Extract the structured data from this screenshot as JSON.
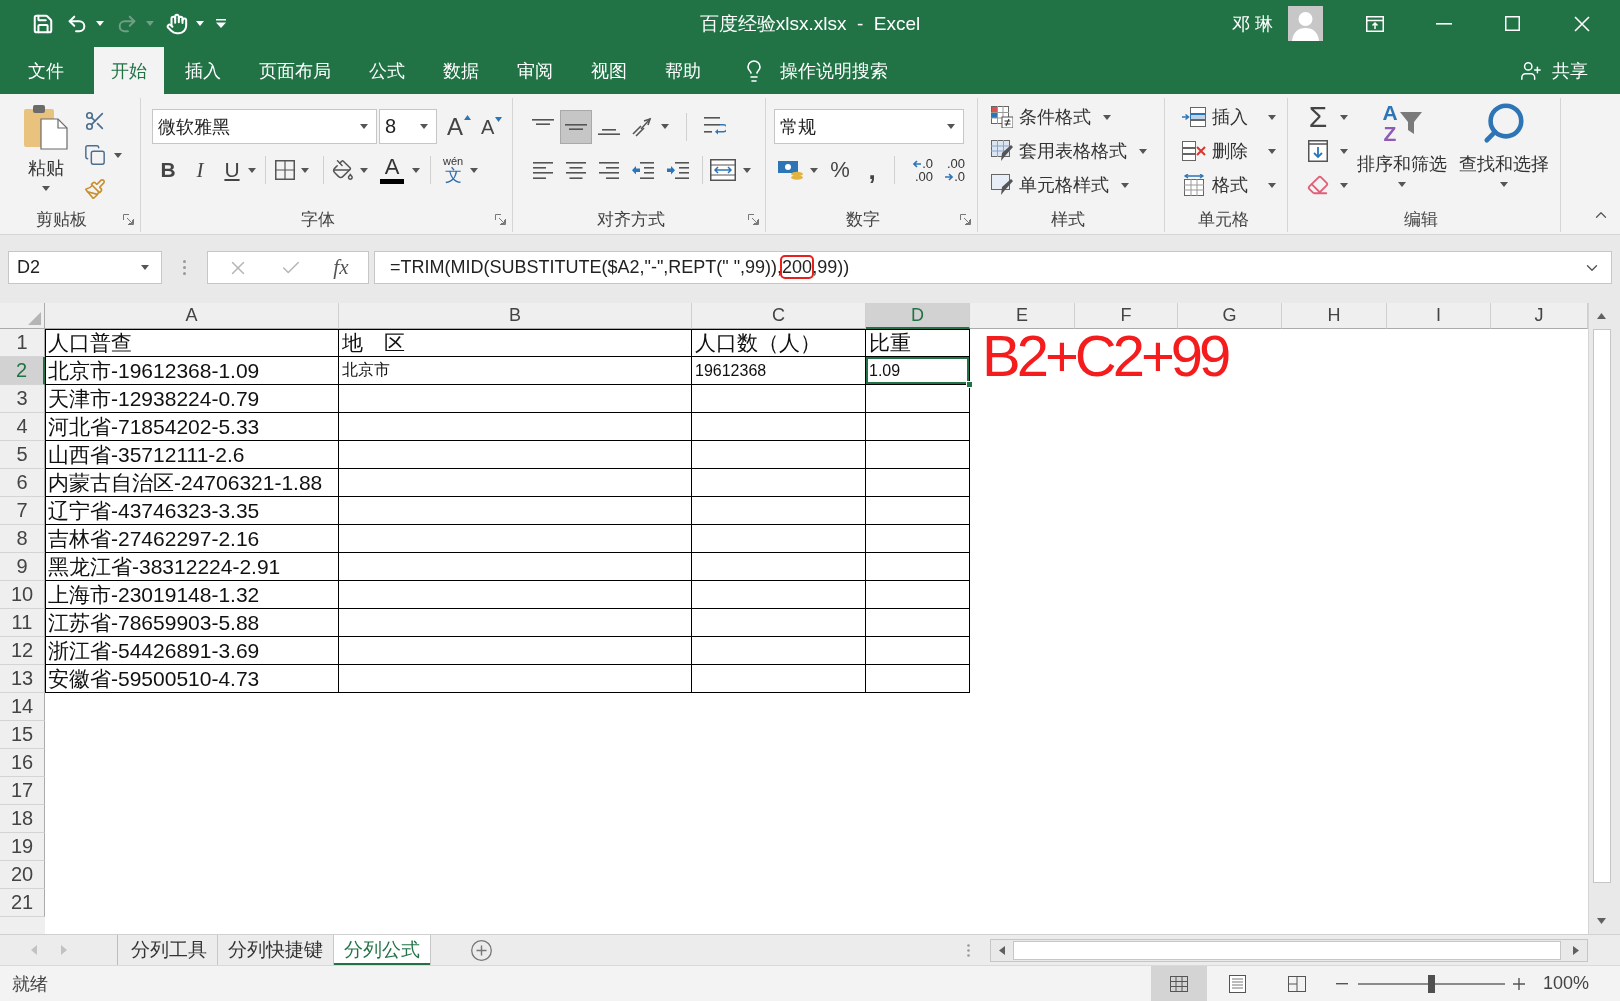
{
  "title_bar": {
    "quick_access": [
      {
        "kind": "save",
        "disabled": false,
        "menu": false
      },
      {
        "kind": "undo",
        "disabled": false,
        "menu": true
      },
      {
        "kind": "redo",
        "disabled": true,
        "menu": true
      },
      {
        "kind": "touch",
        "disabled": false,
        "menu": true
      },
      {
        "kind": "customize",
        "disabled": false,
        "menu": false
      }
    ],
    "title": "百度经验xlsx.xlsx  -  Excel",
    "user": "邓 琳"
  },
  "menu_tabs": [
    {
      "label": "文件",
      "selected": false
    },
    {
      "label": "开始",
      "selected": true
    },
    {
      "label": "插入",
      "selected": false
    },
    {
      "label": "页面布局",
      "selected": false
    },
    {
      "label": "公式",
      "selected": false
    },
    {
      "label": "数据",
      "selected": false
    },
    {
      "label": "审阅",
      "selected": false
    },
    {
      "label": "视图",
      "selected": false
    },
    {
      "label": "帮助",
      "selected": false
    }
  ],
  "tell_me": "操作说明搜索",
  "share": "共享",
  "ribbon": {
    "groups": [
      {
        "kind": "clipboard",
        "label": "剪贴板",
        "launcher": true,
        "paste": "粘贴"
      },
      {
        "kind": "font",
        "label": "字体",
        "launcher": true,
        "font_name": "微软雅黑",
        "font_size": "8",
        "grow": "A",
        "shrink": "A",
        "styles": [
          {
            "kind": "bold",
            "glyph": "B"
          },
          {
            "kind": "italic",
            "glyph": "I"
          },
          {
            "kind": "underline",
            "glyph": "U"
          }
        ],
        "font_color": "A",
        "phonetic": {
          "ruby": "wén",
          "base": "文"
        }
      },
      {
        "kind": "alignment",
        "label": "对齐方式",
        "launcher": true,
        "vertical": [
          {
            "kind": "top",
            "selected": false
          },
          {
            "kind": "middle",
            "selected": true
          },
          {
            "kind": "bottom",
            "selected": false
          }
        ],
        "horizontal": [
          {
            "kind": "left",
            "selected": false
          },
          {
            "kind": "center",
            "selected": false
          },
          {
            "kind": "right",
            "selected": false
          }
        ]
      },
      {
        "kind": "number",
        "label": "数字",
        "launcher": true,
        "format": "常规",
        "percent": "%",
        "comma": ",",
        "increase_decimal": [
          ".0",
          ".00"
        ],
        "decrease_decimal": [
          ".00",
          ".0"
        ]
      },
      {
        "kind": "styles",
        "label": "样式",
        "launcher": false,
        "commands": [
          {
            "kind": "conditional",
            "label": "条件格式"
          },
          {
            "kind": "table",
            "label": "套用表格格式"
          },
          {
            "kind": "cell_styles",
            "label": "单元格样式"
          }
        ]
      },
      {
        "kind": "cells",
        "label": "单元格",
        "launcher": false,
        "commands": [
          {
            "kind": "insert",
            "label": "插入"
          },
          {
            "kind": "delete",
            "label": "删除"
          },
          {
            "kind": "format",
            "label": "格式"
          }
        ]
      },
      {
        "kind": "editing",
        "label": "编辑",
        "launcher": false,
        "autosum": "Σ",
        "sort": {
          "label": "排序和筛选",
          "glyphs": [
            "A",
            "Z"
          ]
        },
        "find": "查找和选择"
      }
    ]
  },
  "formula_bar": {
    "name_box": "D2",
    "insert_function": "fx",
    "formula": [
      {
        "text": "=TRIM(MID(SUBSTITUTE($A2,\"-\",REPT(\" \",99)),",
        "highlighted": false
      },
      {
        "text": "200",
        "highlighted": true
      },
      {
        "text": ",99))",
        "highlighted": false
      }
    ]
  },
  "sheet": {
    "columns": [
      {
        "label": "A",
        "selected": false,
        "bordered": true
      },
      {
        "label": "B",
        "selected": false,
        "bordered": true
      },
      {
        "label": "C",
        "selected": false,
        "bordered": true
      },
      {
        "label": "D",
        "selected": true,
        "bordered": true
      },
      {
        "label": "E",
        "selected": false,
        "bordered": false
      },
      {
        "label": "F",
        "selected": false,
        "bordered": false
      },
      {
        "label": "G",
        "selected": false,
        "bordered": false
      },
      {
        "label": "H",
        "selected": false,
        "bordered": false
      },
      {
        "label": "I",
        "selected": false,
        "bordered": false
      },
      {
        "label": "J",
        "selected": false,
        "bordered": false
      }
    ],
    "rows": [
      {
        "label": "1",
        "selected": false,
        "bordered": true,
        "cells": [
          {
            "text": "人口普查",
            "kind": "large",
            "selected": false
          },
          {
            "text": "地　区",
            "kind": "large",
            "selected": false
          },
          {
            "text": "人口数（人）",
            "kind": "large",
            "selected": false
          },
          {
            "text": "比重",
            "kind": "large",
            "selected": false
          }
        ]
      },
      {
        "label": "2",
        "selected": true,
        "bordered": true,
        "cells": [
          {
            "text": "北京市-19612368-1.09",
            "kind": "large",
            "selected": false
          },
          {
            "text": "北京市",
            "kind": "small",
            "selected": false
          },
          {
            "text": "19612368",
            "kind": "small",
            "selected": false
          },
          {
            "text": "1.09",
            "kind": "small",
            "selected": true
          }
        ]
      },
      {
        "label": "3",
        "selected": false,
        "bordered": true,
        "cells": [
          {
            "text": "天津市-12938224-0.79",
            "kind": "large",
            "selected": false
          }
        ]
      },
      {
        "label": "4",
        "selected": false,
        "bordered": true,
        "cells": [
          {
            "text": "河北省-71854202-5.33",
            "kind": "large",
            "selected": false
          }
        ]
      },
      {
        "label": "5",
        "selected": false,
        "bordered": true,
        "cells": [
          {
            "text": "山西省-35712111-2.6",
            "kind": "large",
            "selected": false
          }
        ]
      },
      {
        "label": "6",
        "selected": false,
        "bordered": true,
        "cells": [
          {
            "text": "内蒙古自治区-24706321-1.88",
            "kind": "large",
            "selected": false
          }
        ]
      },
      {
        "label": "7",
        "selected": false,
        "bordered": true,
        "cells": [
          {
            "text": "辽宁省-43746323-3.35",
            "kind": "large",
            "selected": false
          }
        ]
      },
      {
        "label": "8",
        "selected": false,
        "bordered": true,
        "cells": [
          {
            "text": "吉林省-27462297-2.16",
            "kind": "large",
            "selected": false
          }
        ]
      },
      {
        "label": "9",
        "selected": false,
        "bordered": true,
        "cells": [
          {
            "text": "黑龙江省-38312224-2.91",
            "kind": "large",
            "selected": false
          }
        ]
      },
      {
        "label": "10",
        "selected": false,
        "bordered": true,
        "cells": [
          {
            "text": "上海市-23019148-1.32",
            "kind": "large",
            "selected": false
          }
        ]
      },
      {
        "label": "11",
        "selected": false,
        "bordered": true,
        "cells": [
          {
            "text": "江苏省-78659903-5.88",
            "kind": "large",
            "selected": false
          }
        ]
      },
      {
        "label": "12",
        "selected": false,
        "bordered": true,
        "cells": [
          {
            "text": "浙江省-54426891-3.69",
            "kind": "large",
            "selected": false
          }
        ]
      },
      {
        "label": "13",
        "selected": false,
        "bordered": true,
        "cells": [
          {
            "text": "安徽省-59500510-4.73",
            "kind": "large",
            "selected": false
          }
        ]
      },
      {
        "label": "14",
        "selected": false,
        "bordered": false
      },
      {
        "label": "15",
        "selected": false,
        "bordered": false
      },
      {
        "label": "16",
        "selected": false,
        "bordered": false
      },
      {
        "label": "17",
        "selected": false,
        "bordered": false
      },
      {
        "label": "18",
        "selected": false,
        "bordered": false
      },
      {
        "label": "19",
        "selected": false,
        "bordered": false
      },
      {
        "label": "20",
        "selected": false,
        "bordered": false
      },
      {
        "label": "21",
        "selected": false,
        "bordered": false
      }
    ],
    "annotation": "B2+C2+99"
  },
  "sheet_tabs": [
    {
      "label": "分列工具",
      "selected": false
    },
    {
      "label": "分列快捷键",
      "selected": false
    },
    {
      "label": "分列公式",
      "selected": true
    }
  ],
  "status_bar": {
    "status": "就绪",
    "views": [
      {
        "kind": "normal",
        "selected": true
      },
      {
        "kind": "page_layout",
        "selected": false
      },
      {
        "kind": "page_break",
        "selected": false
      }
    ],
    "zoom": {
      "level": 0.5,
      "reading": "100%"
    }
  }
}
